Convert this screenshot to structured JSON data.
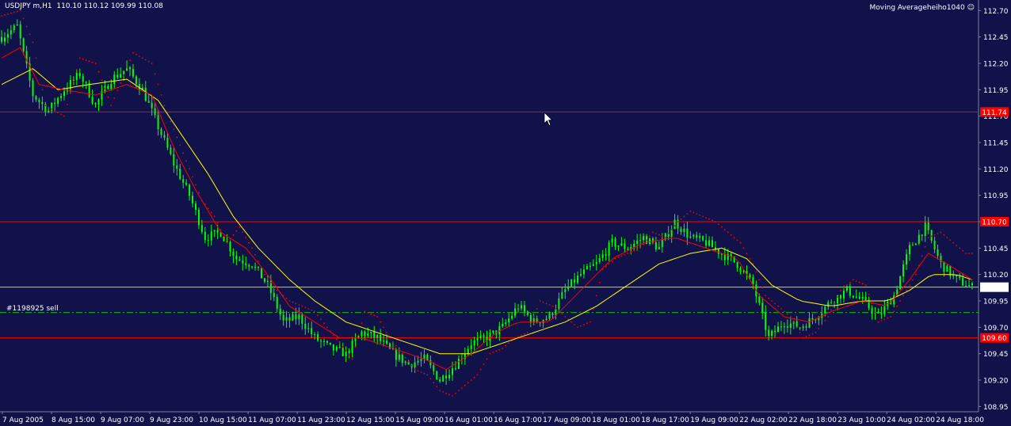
{
  "header": {
    "symbol": "USDJPY m,H1",
    "ohlc": "110.10 110.12 109.99 110.08"
  },
  "indicator": {
    "name": "Moving Averageheiho1040",
    "icon": "smiley-icon"
  },
  "trade_label": "#1198925 sell",
  "colors": {
    "background": "#11124a",
    "candle": "#00ff00",
    "ma_fast": "#ff0000",
    "ma_slow": "#ffff00",
    "sar": "#ff0000",
    "hline": "#ff0000",
    "bid_line": "#c0c0c0",
    "trade_line": "#00c000",
    "axis_text": "#ffffff"
  },
  "chart_data": {
    "type": "line",
    "ylim": [
      108.9,
      112.8
    ],
    "y_ticks": [
      "112.70",
      "112.45",
      "112.20",
      "111.95",
      "111.70",
      "111.45",
      "111.20",
      "110.95",
      "110.70",
      "110.45",
      "110.20",
      "109.95",
      "109.70",
      "109.45",
      "109.20",
      "108.95"
    ],
    "x_ticks": [
      "7 Aug 2005",
      "8 Aug 15:00",
      "9 Aug 07:00",
      "9 Aug 23:00",
      "10 Aug 15:00",
      "11 Aug 07:00",
      "11 Aug 23:00",
      "12 Aug 15:00",
      "15 Aug 09:00",
      "16 Aug 01:00",
      "16 Aug 17:00",
      "17 Aug 09:00",
      "18 Aug 01:00",
      "18 Aug 17:00",
      "19 Aug 09:00",
      "22 Aug 02:00",
      "22 Aug 18:00",
      "23 Aug 10:00",
      "24 Aug 02:00",
      "24 Aug 18:00"
    ],
    "horizontal_lines": [
      {
        "value": 111.74,
        "label": "111.74",
        "style": "solid"
      },
      {
        "value": 110.7,
        "label": "110.70",
        "style": "solid"
      },
      {
        "value": 109.6,
        "label": "109.60",
        "style": "solid"
      },
      {
        "value": 109.84,
        "style": "dashdot"
      },
      {
        "value": 110.08,
        "label": "110.08",
        "style": "bid"
      }
    ],
    "price_path": [
      [
        0,
        112.45
      ],
      [
        5,
        112.55
      ],
      [
        10,
        111.9
      ],
      [
        15,
        111.75
      ],
      [
        20,
        111.95
      ],
      [
        25,
        112.1
      ],
      [
        30,
        111.8
      ],
      [
        35,
        112.05
      ],
      [
        40,
        112.15
      ],
      [
        45,
        111.95
      ],
      [
        50,
        111.6
      ],
      [
        55,
        111.25
      ],
      [
        60,
        110.95
      ],
      [
        65,
        110.55
      ],
      [
        70,
        110.6
      ],
      [
        75,
        110.35
      ],
      [
        80,
        110.3
      ],
      [
        85,
        110.1
      ],
      [
        90,
        109.75
      ],
      [
        95,
        109.8
      ],
      [
        100,
        109.6
      ],
      [
        105,
        109.5
      ],
      [
        110,
        109.45
      ],
      [
        115,
        109.65
      ],
      [
        120,
        109.6
      ],
      [
        125,
        109.45
      ],
      [
        130,
        109.35
      ],
      [
        135,
        109.4
      ],
      [
        140,
        109.2
      ],
      [
        145,
        109.35
      ],
      [
        150,
        109.55
      ],
      [
        155,
        109.6
      ],
      [
        160,
        109.7
      ],
      [
        165,
        109.9
      ],
      [
        170,
        109.75
      ],
      [
        175,
        109.8
      ],
      [
        180,
        110.05
      ],
      [
        185,
        110.2
      ],
      [
        190,
        110.3
      ],
      [
        195,
        110.5
      ],
      [
        200,
        110.45
      ],
      [
        205,
        110.55
      ],
      [
        210,
        110.45
      ],
      [
        215,
        110.7
      ],
      [
        220,
        110.55
      ],
      [
        225,
        110.5
      ],
      [
        230,
        110.4
      ],
      [
        235,
        110.3
      ],
      [
        240,
        110.1
      ],
      [
        245,
        109.6
      ],
      [
        250,
        109.75
      ],
      [
        255,
        109.7
      ],
      [
        260,
        109.8
      ],
      [
        265,
        109.95
      ],
      [
        270,
        110.05
      ],
      [
        275,
        109.95
      ],
      [
        280,
        109.8
      ],
      [
        285,
        110.0
      ],
      [
        290,
        110.45
      ],
      [
        295,
        110.65
      ],
      [
        300,
        110.3
      ],
      [
        305,
        110.15
      ],
      [
        310,
        110.08
      ]
    ],
    "ma_fast_path": [
      [
        0,
        112.25
      ],
      [
        6,
        112.35
      ],
      [
        12,
        112.0
      ],
      [
        20,
        111.95
      ],
      [
        30,
        111.9
      ],
      [
        40,
        112.0
      ],
      [
        48,
        111.9
      ],
      [
        55,
        111.4
      ],
      [
        62,
        111.0
      ],
      [
        70,
        110.6
      ],
      [
        78,
        110.45
      ],
      [
        85,
        110.2
      ],
      [
        92,
        109.9
      ],
      [
        100,
        109.75
      ],
      [
        108,
        109.6
      ],
      [
        115,
        109.6
      ],
      [
        125,
        109.5
      ],
      [
        135,
        109.4
      ],
      [
        142,
        109.3
      ],
      [
        150,
        109.45
      ],
      [
        158,
        109.65
      ],
      [
        165,
        109.75
      ],
      [
        175,
        109.75
      ],
      [
        185,
        110.05
      ],
      [
        195,
        110.35
      ],
      [
        205,
        110.5
      ],
      [
        215,
        110.55
      ],
      [
        225,
        110.45
      ],
      [
        235,
        110.35
      ],
      [
        242,
        110.0
      ],
      [
        250,
        109.8
      ],
      [
        258,
        109.75
      ],
      [
        265,
        109.85
      ],
      [
        275,
        109.95
      ],
      [
        283,
        109.9
      ],
      [
        290,
        110.15
      ],
      [
        296,
        110.4
      ],
      [
        302,
        110.3
      ],
      [
        310,
        110.15
      ]
    ],
    "ma_slow_path": [
      [
        0,
        112.0
      ],
      [
        10,
        112.15
      ],
      [
        18,
        111.95
      ],
      [
        28,
        112.0
      ],
      [
        40,
        112.05
      ],
      [
        50,
        111.85
      ],
      [
        58,
        111.5
      ],
      [
        66,
        111.15
      ],
      [
        74,
        110.75
      ],
      [
        82,
        110.45
      ],
      [
        92,
        110.15
      ],
      [
        100,
        109.95
      ],
      [
        110,
        109.75
      ],
      [
        120,
        109.65
      ],
      [
        130,
        109.55
      ],
      [
        140,
        109.45
      ],
      [
        150,
        109.45
      ],
      [
        160,
        109.55
      ],
      [
        170,
        109.65
      ],
      [
        180,
        109.75
      ],
      [
        190,
        109.9
      ],
      [
        200,
        110.1
      ],
      [
        210,
        110.3
      ],
      [
        220,
        110.4
      ],
      [
        230,
        110.45
      ],
      [
        238,
        110.35
      ],
      [
        246,
        110.1
      ],
      [
        255,
        109.95
      ],
      [
        265,
        109.9
      ],
      [
        275,
        109.95
      ],
      [
        283,
        109.95
      ],
      [
        290,
        110.05
      ],
      [
        297,
        110.2
      ],
      [
        305,
        110.2
      ],
      [
        310,
        110.15
      ]
    ],
    "sar_path": [
      [
        0,
        112.65
      ],
      [
        6,
        112.7
      ],
      [
        10,
        112.4
      ],
      [
        14,
        111.8
      ],
      [
        20,
        111.7
      ],
      [
        25,
        112.25
      ],
      [
        30,
        112.2
      ],
      [
        35,
        111.8
      ],
      [
        42,
        112.3
      ],
      [
        48,
        112.2
      ],
      [
        52,
        111.8
      ],
      [
        56,
        111.5
      ],
      [
        60,
        111.2
      ],
      [
        64,
        110.9
      ],
      [
        68,
        110.75
      ],
      [
        72,
        110.5
      ],
      [
        76,
        110.65
      ],
      [
        80,
        110.45
      ],
      [
        84,
        110.2
      ],
      [
        88,
        110.05
      ],
      [
        92,
        109.95
      ],
      [
        96,
        109.9
      ],
      [
        100,
        109.85
      ],
      [
        104,
        109.7
      ],
      [
        108,
        109.55
      ],
      [
        112,
        109.4
      ],
      [
        116,
        109.85
      ],
      [
        120,
        109.8
      ],
      [
        124,
        109.6
      ],
      [
        128,
        109.45
      ],
      [
        132,
        109.3
      ],
      [
        136,
        109.25
      ],
      [
        140,
        109.1
      ],
      [
        144,
        109.05
      ],
      [
        148,
        109.15
      ],
      [
        152,
        109.25
      ],
      [
        156,
        109.45
      ],
      [
        160,
        109.5
      ],
      [
        164,
        109.6
      ],
      [
        168,
        109.65
      ],
      [
        172,
        109.95
      ],
      [
        176,
        109.9
      ],
      [
        180,
        109.8
      ],
      [
        184,
        109.7
      ],
      [
        188,
        109.75
      ],
      [
        192,
        110.25
      ],
      [
        196,
        110.35
      ],
      [
        200,
        110.4
      ],
      [
        204,
        110.45
      ],
      [
        208,
        110.6
      ],
      [
        212,
        110.55
      ],
      [
        216,
        110.7
      ],
      [
        220,
        110.8
      ],
      [
        224,
        110.75
      ],
      [
        228,
        110.7
      ],
      [
        232,
        110.6
      ],
      [
        236,
        110.5
      ],
      [
        240,
        110.3
      ],
      [
        244,
        110.0
      ],
      [
        248,
        109.9
      ],
      [
        252,
        109.8
      ],
      [
        256,
        109.6
      ],
      [
        260,
        109.65
      ],
      [
        264,
        109.8
      ],
      [
        268,
        110.05
      ],
      [
        272,
        110.15
      ],
      [
        276,
        110.1
      ],
      [
        280,
        109.75
      ],
      [
        284,
        109.8
      ],
      [
        288,
        110.0
      ],
      [
        292,
        110.2
      ],
      [
        296,
        110.55
      ],
      [
        300,
        110.6
      ],
      [
        304,
        110.5
      ],
      [
        308,
        110.4
      ]
    ]
  }
}
